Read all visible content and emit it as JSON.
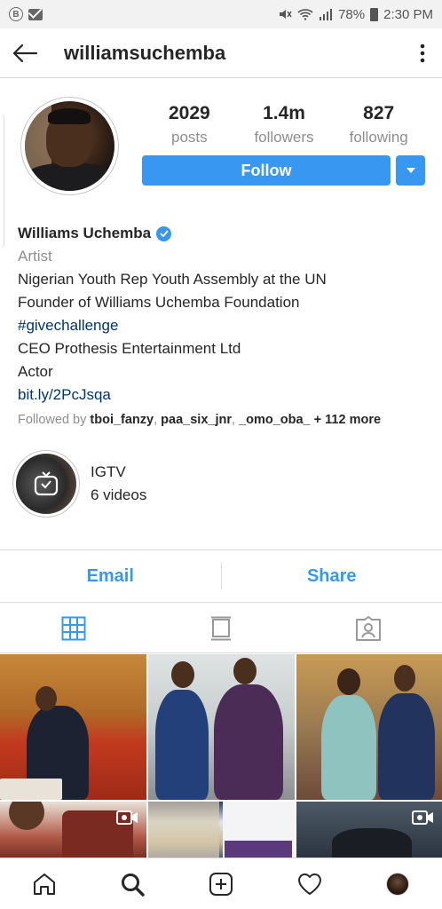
{
  "status_bar": {
    "badge_letter": "B",
    "battery": "78%",
    "time": "2:30 PM",
    "icons": [
      "b-badge-icon",
      "mail-icon",
      "mute-icon",
      "wifi-icon",
      "signal-icon",
      "battery-icon"
    ]
  },
  "header": {
    "username": "williamsuchemba",
    "back_icon": "arrow-left-icon",
    "more_icon": "vertical-dots-icon"
  },
  "stats": [
    {
      "value": "2029",
      "label": "posts"
    },
    {
      "value": "1.4m",
      "label": "followers"
    },
    {
      "value": "827",
      "label": "following"
    }
  ],
  "actions": {
    "follow_label": "Follow",
    "dropdown_icon": "triangle-down-icon"
  },
  "bio": {
    "name": "Williams Uchemba",
    "category": "Artist",
    "lines": [
      "Nigerian Youth Rep Youth Assembly at the UN",
      "Founder of Williams Uchemba Foundation"
    ],
    "hashtag": "#givechallenge",
    "lines2": [
      "CEO Prothesis Entertainment Ltd",
      "Actor"
    ],
    "link": "bit.ly/2PcJsqa",
    "followed_by_prefix": "Followed by",
    "followers_names": [
      "tboi_fanzy",
      "paa_six_jnr",
      "_omo_oba_"
    ],
    "followed_by_more": "+ 112 more"
  },
  "igtv": {
    "title": "IGTV",
    "count": "6 videos"
  },
  "contact": {
    "email_label": "Email",
    "share_label": "Share"
  },
  "tabs": [
    "grid-icon",
    "feed-icon",
    "tagged-icon"
  ],
  "colors": {
    "accent": "#3897f0",
    "link": "#003569",
    "muted": "#8e8e8e",
    "text": "#262626",
    "divider": "#dbdbdb"
  },
  "bottom_nav": [
    "home-icon",
    "search-icon",
    "add-icon",
    "heart-icon",
    "profile-avatar"
  ]
}
